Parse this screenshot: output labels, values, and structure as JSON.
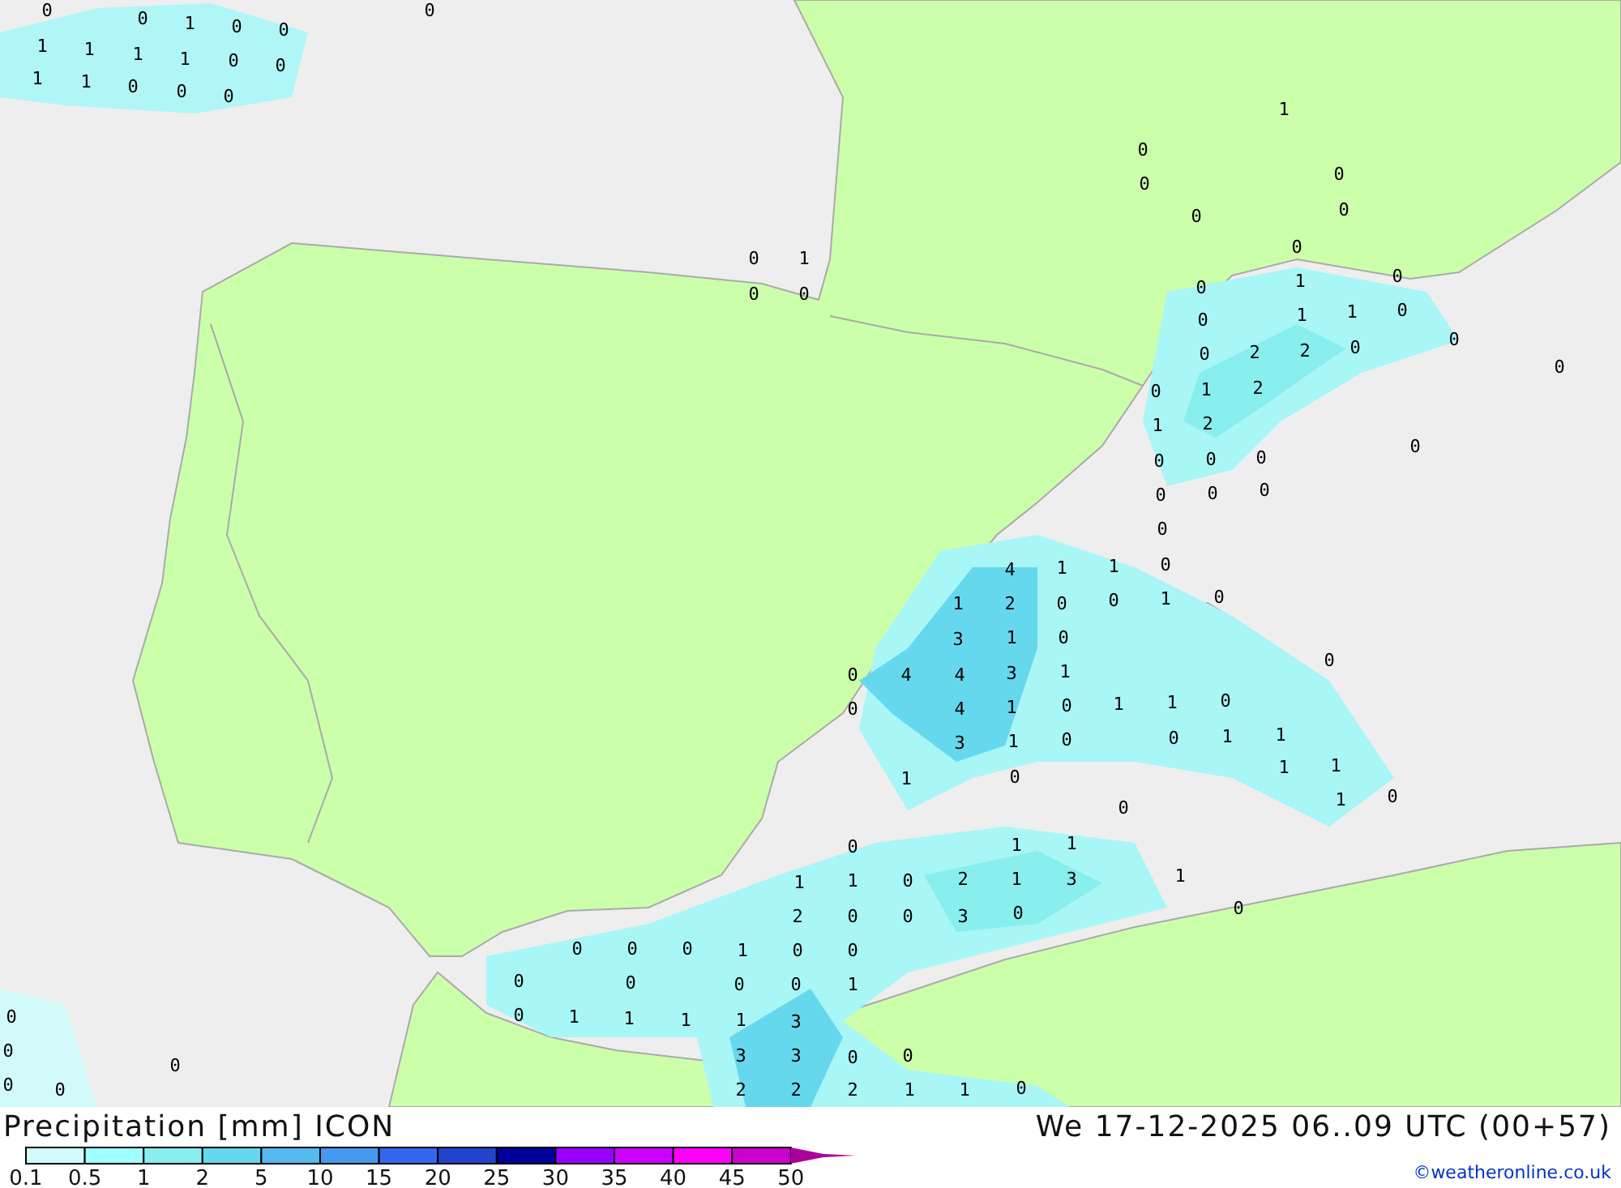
{
  "map": {
    "values": [
      "0",
      "0",
      "1",
      "0",
      "0",
      "0",
      "1",
      "1",
      "1",
      "1",
      "0",
      "0",
      "1",
      "1",
      "0",
      "0",
      "0",
      "1",
      "0",
      "0",
      "0",
      "0",
      "0",
      "0",
      "0",
      "1",
      "0",
      "0",
      "0",
      "1",
      "0",
      "0",
      "1",
      "1",
      "0",
      "0",
      "0",
      "2",
      "2",
      "0",
      "0",
      "1",
      "2",
      "1",
      "2",
      "0",
      "0",
      "0",
      "0",
      "0",
      "0",
      "0",
      "0",
      "0",
      "4",
      "1",
      "1",
      "0",
      "1",
      "2",
      "0",
      "0",
      "1",
      "0",
      "3",
      "1",
      "0",
      "0",
      "4",
      "4",
      "3",
      "1",
      "0",
      "0",
      "4",
      "1",
      "0",
      "1",
      "1",
      "0",
      "3",
      "1",
      "0",
      "0",
      "1",
      "1",
      "1",
      "0",
      "1",
      "1",
      "0",
      "1",
      "0",
      "0",
      "1",
      "1",
      "1",
      "1",
      "0",
      "2",
      "1",
      "3",
      "1",
      "2",
      "0",
      "0",
      "3",
      "0",
      "0",
      "0",
      "0",
      "0",
      "1",
      "0",
      "0",
      "0",
      "0",
      "0",
      "0",
      "1",
      "0",
      "1",
      "1",
      "1",
      "1",
      "3",
      "3",
      "3",
      "0",
      "0",
      "2",
      "2",
      "2",
      "1",
      "1",
      "0",
      "0",
      "0",
      "0",
      "0",
      "0"
    ]
  },
  "footer": {
    "title": "Precipitation [mm] ICON",
    "datetime": "We 17-12-2025 06..09 UTC (00+57)",
    "credit": "©weatheronline.co.uk"
  },
  "legend": [
    {
      "kind": "cell",
      "label": "0.1",
      "color": "#d2fafa"
    },
    {
      "kind": "cell",
      "label": "0.5",
      "color": "#a0ffff"
    },
    {
      "kind": "cell",
      "label": "1",
      "color": "#88eeee"
    },
    {
      "kind": "cell",
      "label": "2",
      "color": "#66d8ee"
    },
    {
      "kind": "cell",
      "label": "5",
      "color": "#55bbee"
    },
    {
      "kind": "cell",
      "label": "10",
      "color": "#4499ee"
    },
    {
      "kind": "cell",
      "label": "15",
      "color": "#3366ee"
    },
    {
      "kind": "cell",
      "label": "20",
      "color": "#2244cc"
    },
    {
      "kind": "cell",
      "label": "25",
      "color": "#000099"
    },
    {
      "kind": "cell",
      "label": "30",
      "color": "#9900ff"
    },
    {
      "kind": "cell",
      "label": "35",
      "color": "#cc00ff"
    },
    {
      "kind": "cell",
      "label": "40",
      "color": "#ff00ff"
    },
    {
      "kind": "cell",
      "label": "45",
      "color": "#cc00cc"
    },
    {
      "kind": "arrow",
      "label": "50",
      "color": "#aa0099"
    }
  ]
}
